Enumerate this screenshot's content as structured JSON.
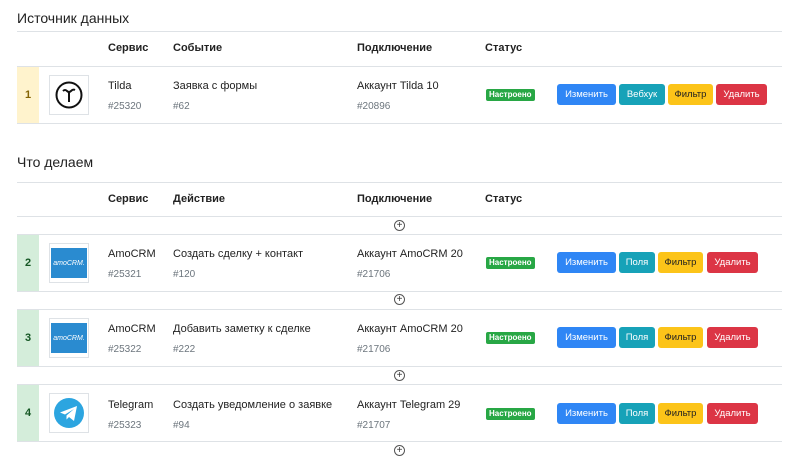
{
  "source": {
    "title": "Источник данных",
    "headers": {
      "service": "Сервис",
      "event": "Событие",
      "connection": "Подключение",
      "status": "Статус"
    },
    "row": {
      "num": "1",
      "service": "Tilda",
      "service_id": "#25320",
      "event": "Заявка с формы",
      "event_id": "#62",
      "connection": "Аккаунт Tilda 10",
      "connection_id": "#20896",
      "status": "Настроено",
      "logo_icon": "tilda-logo-icon",
      "buttons": {
        "edit": "Изменить",
        "webhook": "Вебхук",
        "filter": "Фильтр",
        "delete": "Удалить"
      }
    }
  },
  "actions": {
    "title": "Что делаем",
    "headers": {
      "service": "Сервис",
      "action": "Действие",
      "connection": "Подключение",
      "status": "Статус"
    },
    "add_icon": "plus-circle-icon",
    "rows": [
      {
        "num": "2",
        "service": "AmoCRM",
        "service_id": "#25321",
        "action": "Создать сделку + контакт",
        "action_id": "#120",
        "connection": "Аккаунт AmoCRM 20",
        "connection_id": "#21706",
        "status": "Настроено",
        "logo_icon": "amocrm-logo-icon",
        "logo_text": "amoCRM.",
        "buttons": {
          "edit": "Изменить",
          "fields": "Поля",
          "filter": "Фильтр",
          "delete": "Удалить"
        }
      },
      {
        "num": "3",
        "service": "AmoCRM",
        "service_id": "#25322",
        "action": "Добавить заметку к сделке",
        "action_id": "#222",
        "connection": "Аккаунт AmoCRM 20",
        "connection_id": "#21706",
        "status": "Настроено",
        "logo_icon": "amocrm-logo-icon",
        "logo_text": "amoCRM.",
        "buttons": {
          "edit": "Изменить",
          "fields": "Поля",
          "filter": "Фильтр",
          "delete": "Удалить"
        }
      },
      {
        "num": "4",
        "service": "Telegram",
        "service_id": "#25323",
        "action": "Создать уведомление о заявке",
        "action_id": "#94",
        "connection": "Аккаунт Telegram 29",
        "connection_id": "#21707",
        "status": "Настроено",
        "logo_icon": "telegram-logo-icon",
        "buttons": {
          "edit": "Изменить",
          "fields": "Поля",
          "filter": "Фильтр",
          "delete": "Удалить"
        }
      }
    ]
  },
  "colors": {
    "edit": "#2f86f5",
    "fields": "#17a2b8",
    "filter": "#fcc419",
    "delete": "#dc3545",
    "status": "#28a745",
    "telegram": "#2ca5e0",
    "amocrm": "#2a8bd0"
  }
}
